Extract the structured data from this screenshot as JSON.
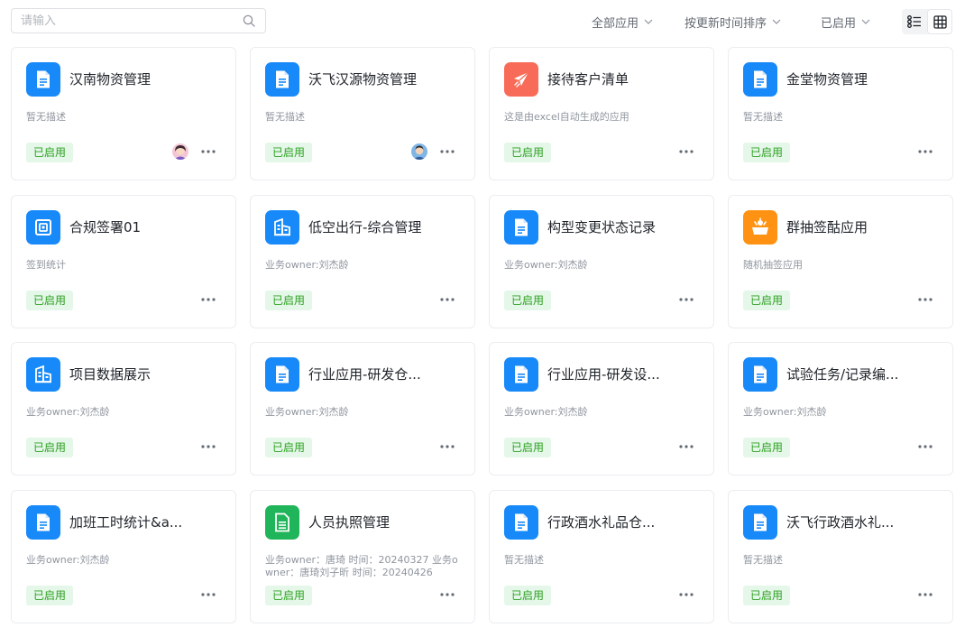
{
  "search": {
    "placeholder": "请输入",
    "value": ""
  },
  "filters": {
    "scope": "全部应用",
    "sort": "按更新时间排序",
    "status": "已启用"
  },
  "view_mode": {
    "options": [
      "list",
      "grid"
    ],
    "selected": "grid"
  },
  "status_color": "#2ea121",
  "apps": [
    {
      "name": "汉南物资管理",
      "desc": "暂无描述",
      "status": "已启用",
      "icon": "document-icon",
      "color": "#1789f8",
      "avatar": "female-avatar"
    },
    {
      "name": "沃飞汉源物资管理",
      "desc": "暂无描述",
      "status": "已启用",
      "icon": "document-icon",
      "color": "#1789f8",
      "avatar": "male-avatar"
    },
    {
      "name": "接待客户清单",
      "desc": "这是由excel自动生成的应用",
      "status": "已启用",
      "icon": "plane-icon",
      "color": "#f76b58"
    },
    {
      "name": "金堂物资管理",
      "desc": "暂无描述",
      "status": "已启用",
      "icon": "document-icon",
      "color": "#1789f8"
    },
    {
      "name": "合规签署01",
      "desc": "签到统计",
      "status": "已启用",
      "icon": "register-icon",
      "color": "#1789f8"
    },
    {
      "name": "低空出行-综合管理",
      "desc": "业务owner:刘杰龄",
      "status": "已启用",
      "icon": "building-icon",
      "color": "#1789f8"
    },
    {
      "name": "构型变更状态记录",
      "desc": "业务owner:刘杰龄",
      "status": "已启用",
      "icon": "document-icon",
      "color": "#1789f8"
    },
    {
      "name": "群抽签酤应用",
      "desc": "随机抽签应用",
      "status": "已启用",
      "icon": "gift-icon",
      "color": "#ff9213"
    },
    {
      "name": "项目数据展示",
      "desc": "业务owner:刘杰龄",
      "status": "已启用",
      "icon": "building-icon",
      "color": "#1789f8"
    },
    {
      "name": "行业应用-研发仓...",
      "desc": "业务owner:刘杰龄",
      "status": "已启用",
      "icon": "document-icon",
      "color": "#1789f8"
    },
    {
      "name": "行业应用-研发设...",
      "desc": "业务owner:刘杰龄",
      "status": "已启用",
      "icon": "document-icon",
      "color": "#1789f8"
    },
    {
      "name": "试验任务/记录编...",
      "desc": "业务owner:刘杰龄",
      "status": "已启用",
      "icon": "document-icon",
      "color": "#1789f8"
    },
    {
      "name": "加班工时统计&a...",
      "desc": "业务owner:刘杰龄",
      "status": "已启用",
      "icon": "document-icon",
      "color": "#1789f8"
    },
    {
      "name": "人员执照管理",
      "desc": "业务owner：唐琦 时间：20240327 业务owner：唐琦刘子昕 时间：20240426",
      "status": "已启用",
      "icon": "sheet-icon",
      "color": "#21b55b"
    },
    {
      "name": "行政酒水礼品仓...",
      "desc": "暂无描述",
      "status": "已启用",
      "icon": "document-icon",
      "color": "#1789f8"
    },
    {
      "name": "沃飞行政酒水礼...",
      "desc": "暂无描述",
      "status": "已启用",
      "icon": "document-icon",
      "color": "#1789f8"
    }
  ]
}
